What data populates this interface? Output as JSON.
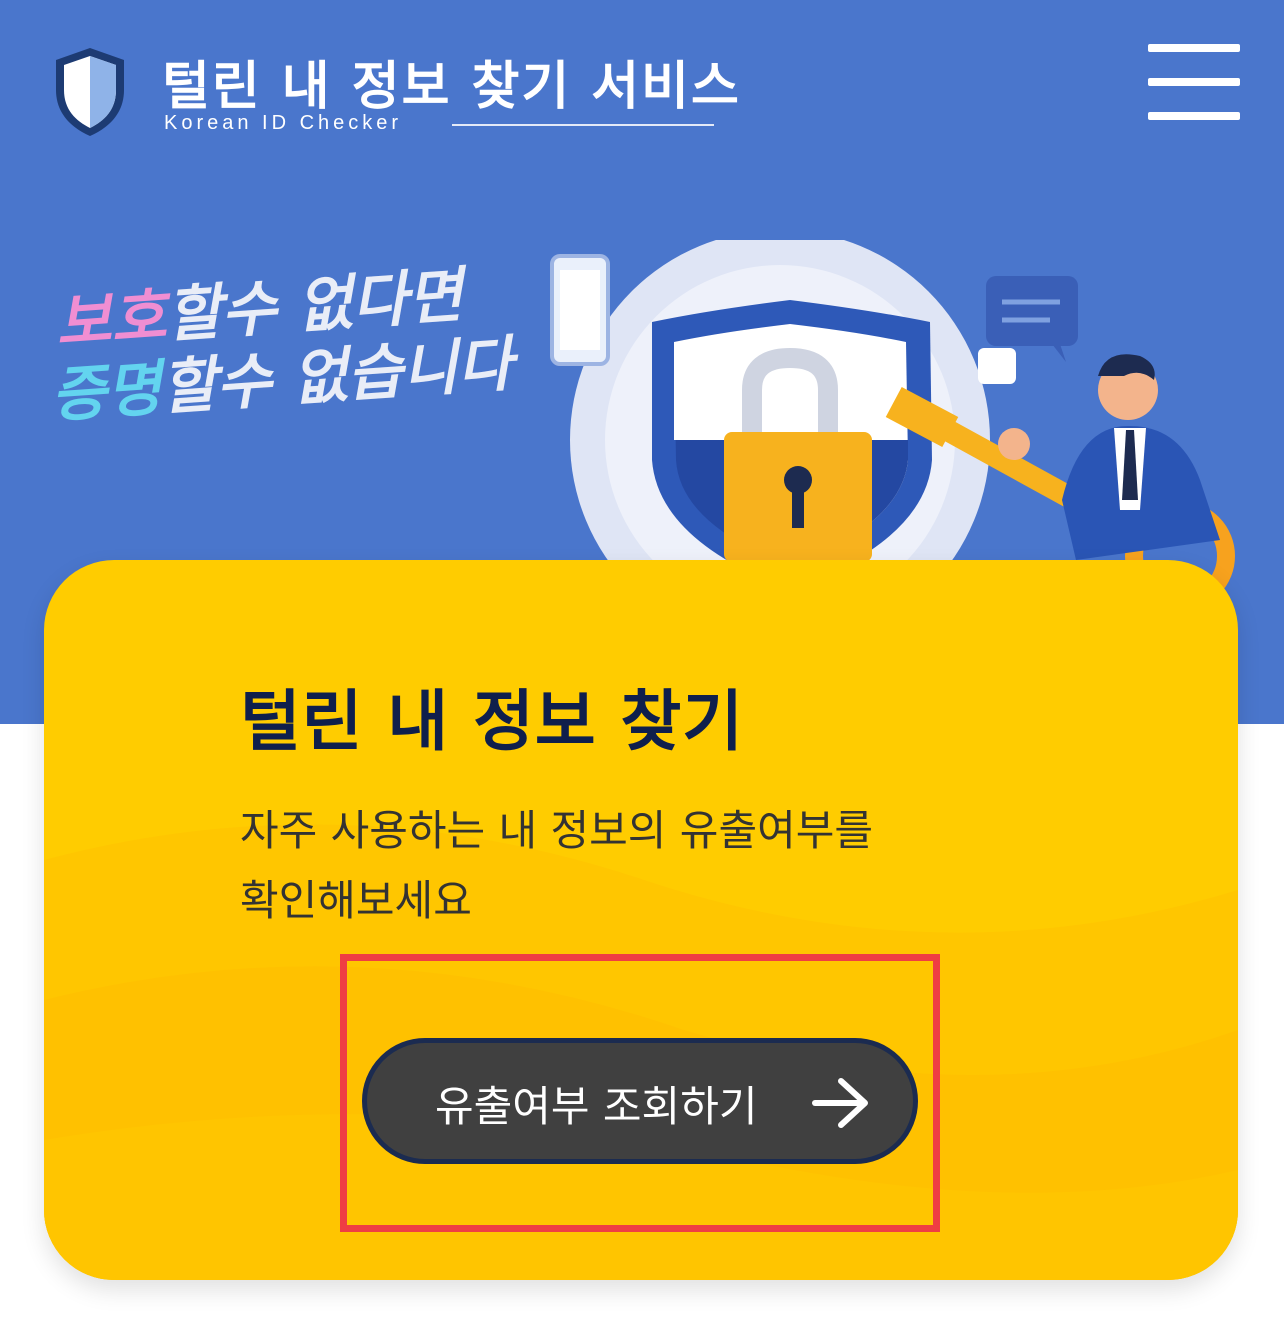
{
  "header": {
    "title": "털린 내 정보 찾기 서비스",
    "subtitle": "Korean ID Checker",
    "logo_icon": "shield-icon",
    "menu_icon": "hamburger-menu-icon"
  },
  "hero": {
    "slogan_line1_prefix": "보호",
    "slogan_line1_rest": "할수 없다면",
    "slogan_line2_prefix": "증명",
    "slogan_line2_rest": "할수 없습니다",
    "illustration": "security-shield-padlock-key-illustration"
  },
  "card": {
    "title": "털린 내 정보 찾기",
    "description_line1": "자주 사용하는 내 정보의 유출여부를",
    "description_line2": "확인해보세요",
    "button_label": "유출여부 조회하기",
    "button_icon": "arrow-right-icon"
  },
  "colors": {
    "hero_background": "#4a76cc",
    "card_background": "#ffcc00",
    "title_color": "#0f1f4c",
    "button_background": "#404040",
    "highlight": "#ef3e43"
  }
}
